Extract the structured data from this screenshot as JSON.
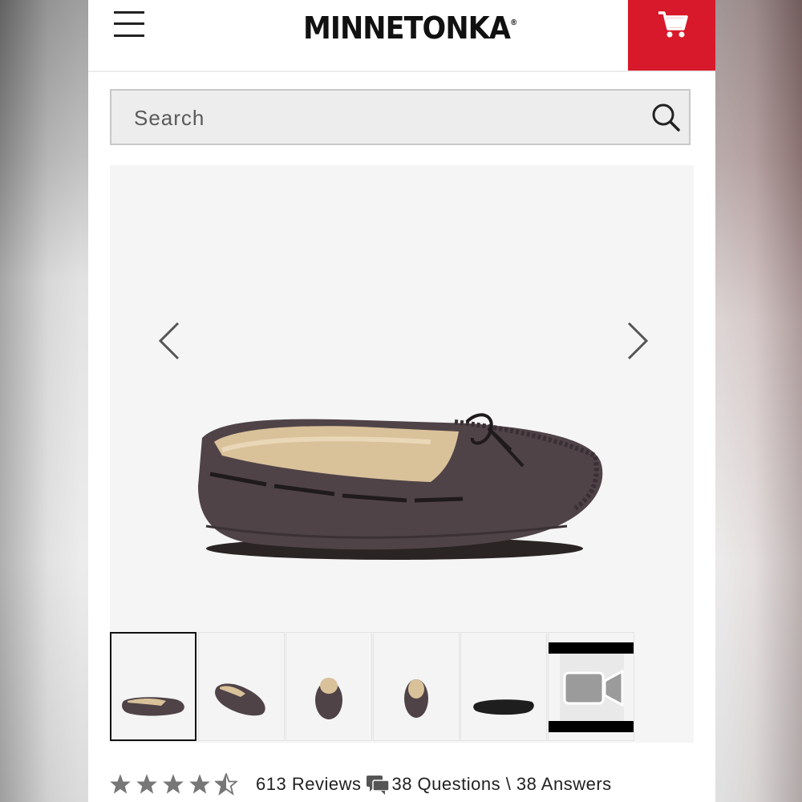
{
  "header": {
    "brand": "MINNETONKA",
    "registered_mark": "®",
    "brand_color": "#d7192b",
    "icons": {
      "menu": "hamburger-menu-icon",
      "cart": "shopping-cart-icon"
    }
  },
  "search": {
    "placeholder": "Search",
    "value": "",
    "icon": "search-icon"
  },
  "gallery": {
    "thumbnail_count": 6,
    "selected_thumbnail": 1,
    "thumbnails": [
      {
        "view": "side"
      },
      {
        "view": "angle"
      },
      {
        "view": "front"
      },
      {
        "view": "back"
      },
      {
        "view": "sole"
      },
      {
        "view": "video"
      }
    ],
    "icons": {
      "prev": "chevron-left-icon",
      "next": "chevron-right-icon",
      "video": "video-camera-icon"
    }
  },
  "product": {
    "rating": 4.5,
    "rating_max": 5,
    "reviews_label": "613 Reviews",
    "qa_label": "38 Questions \\ 38 Answers",
    "icons": {
      "star": "star-icon",
      "qa": "chat-bubbles-icon"
    }
  }
}
